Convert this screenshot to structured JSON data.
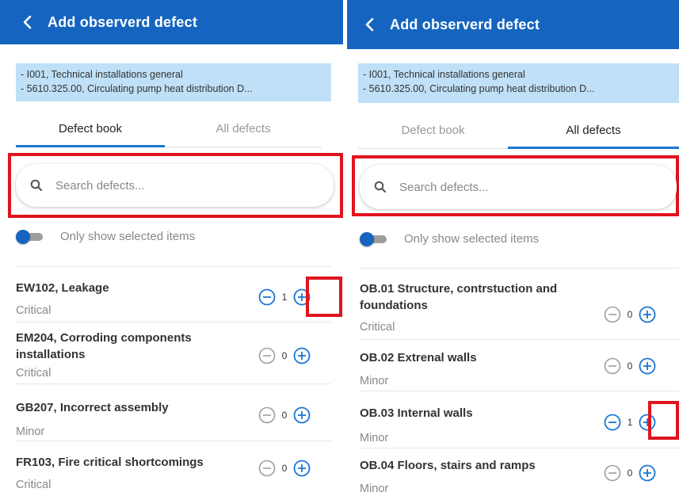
{
  "left": {
    "header": {
      "title": "Add observerd defect"
    },
    "info_lines": [
      "- I001, Technical installations general",
      "- 5610.325.00, Circulating pump heat distribution D..."
    ],
    "tabs": [
      "Defect book",
      "All defects"
    ],
    "search": {
      "placeholder": "Search defects..."
    },
    "toggle_label": "Only show selected items",
    "items": [
      {
        "name": "EW102, Leakage",
        "severity": "Critical",
        "count": "1"
      },
      {
        "name": "EM204, Corroding components installations",
        "severity": "Critical",
        "count": "0"
      },
      {
        "name": "GB207, Incorrect assembly",
        "severity": "Minor",
        "count": "0"
      },
      {
        "name": "FR103, Fire critical shortcomings",
        "severity": "Critical",
        "count": "0"
      }
    ]
  },
  "right": {
    "header": {
      "title": "Add observerd defect"
    },
    "info_lines": [
      "- I001, Technical installations general",
      "- 5610.325.00, Circulating pump heat distribution D..."
    ],
    "tabs": [
      "Defect book",
      "All defects"
    ],
    "search": {
      "placeholder": "Search defects..."
    },
    "toggle_label": "Only show selected items",
    "items": [
      {
        "name": "OB.01 Structure, contrstuction and foundations",
        "severity": "Critical",
        "count": "0"
      },
      {
        "name": "OB.02 Extrenal walls",
        "severity": "Minor",
        "count": "0"
      },
      {
        "name": "OB.03 Internal walls",
        "severity": "Minor",
        "count": "1"
      },
      {
        "name": "OB.04 Floors, stairs and ramps",
        "severity": "Minor",
        "count": "0"
      }
    ]
  },
  "colors": {
    "header": "#1565c0",
    "info_bg": "#bfe0f7",
    "accent": "#1976d2",
    "highlight": "#e0141e",
    "button_active": "#1976d2",
    "button_inactive": "#9e9e9e"
  },
  "icons": {
    "back": "chevron-left-icon",
    "search": "search-icon",
    "increment": "plus-circle-icon",
    "decrement": "minus-circle-icon"
  }
}
